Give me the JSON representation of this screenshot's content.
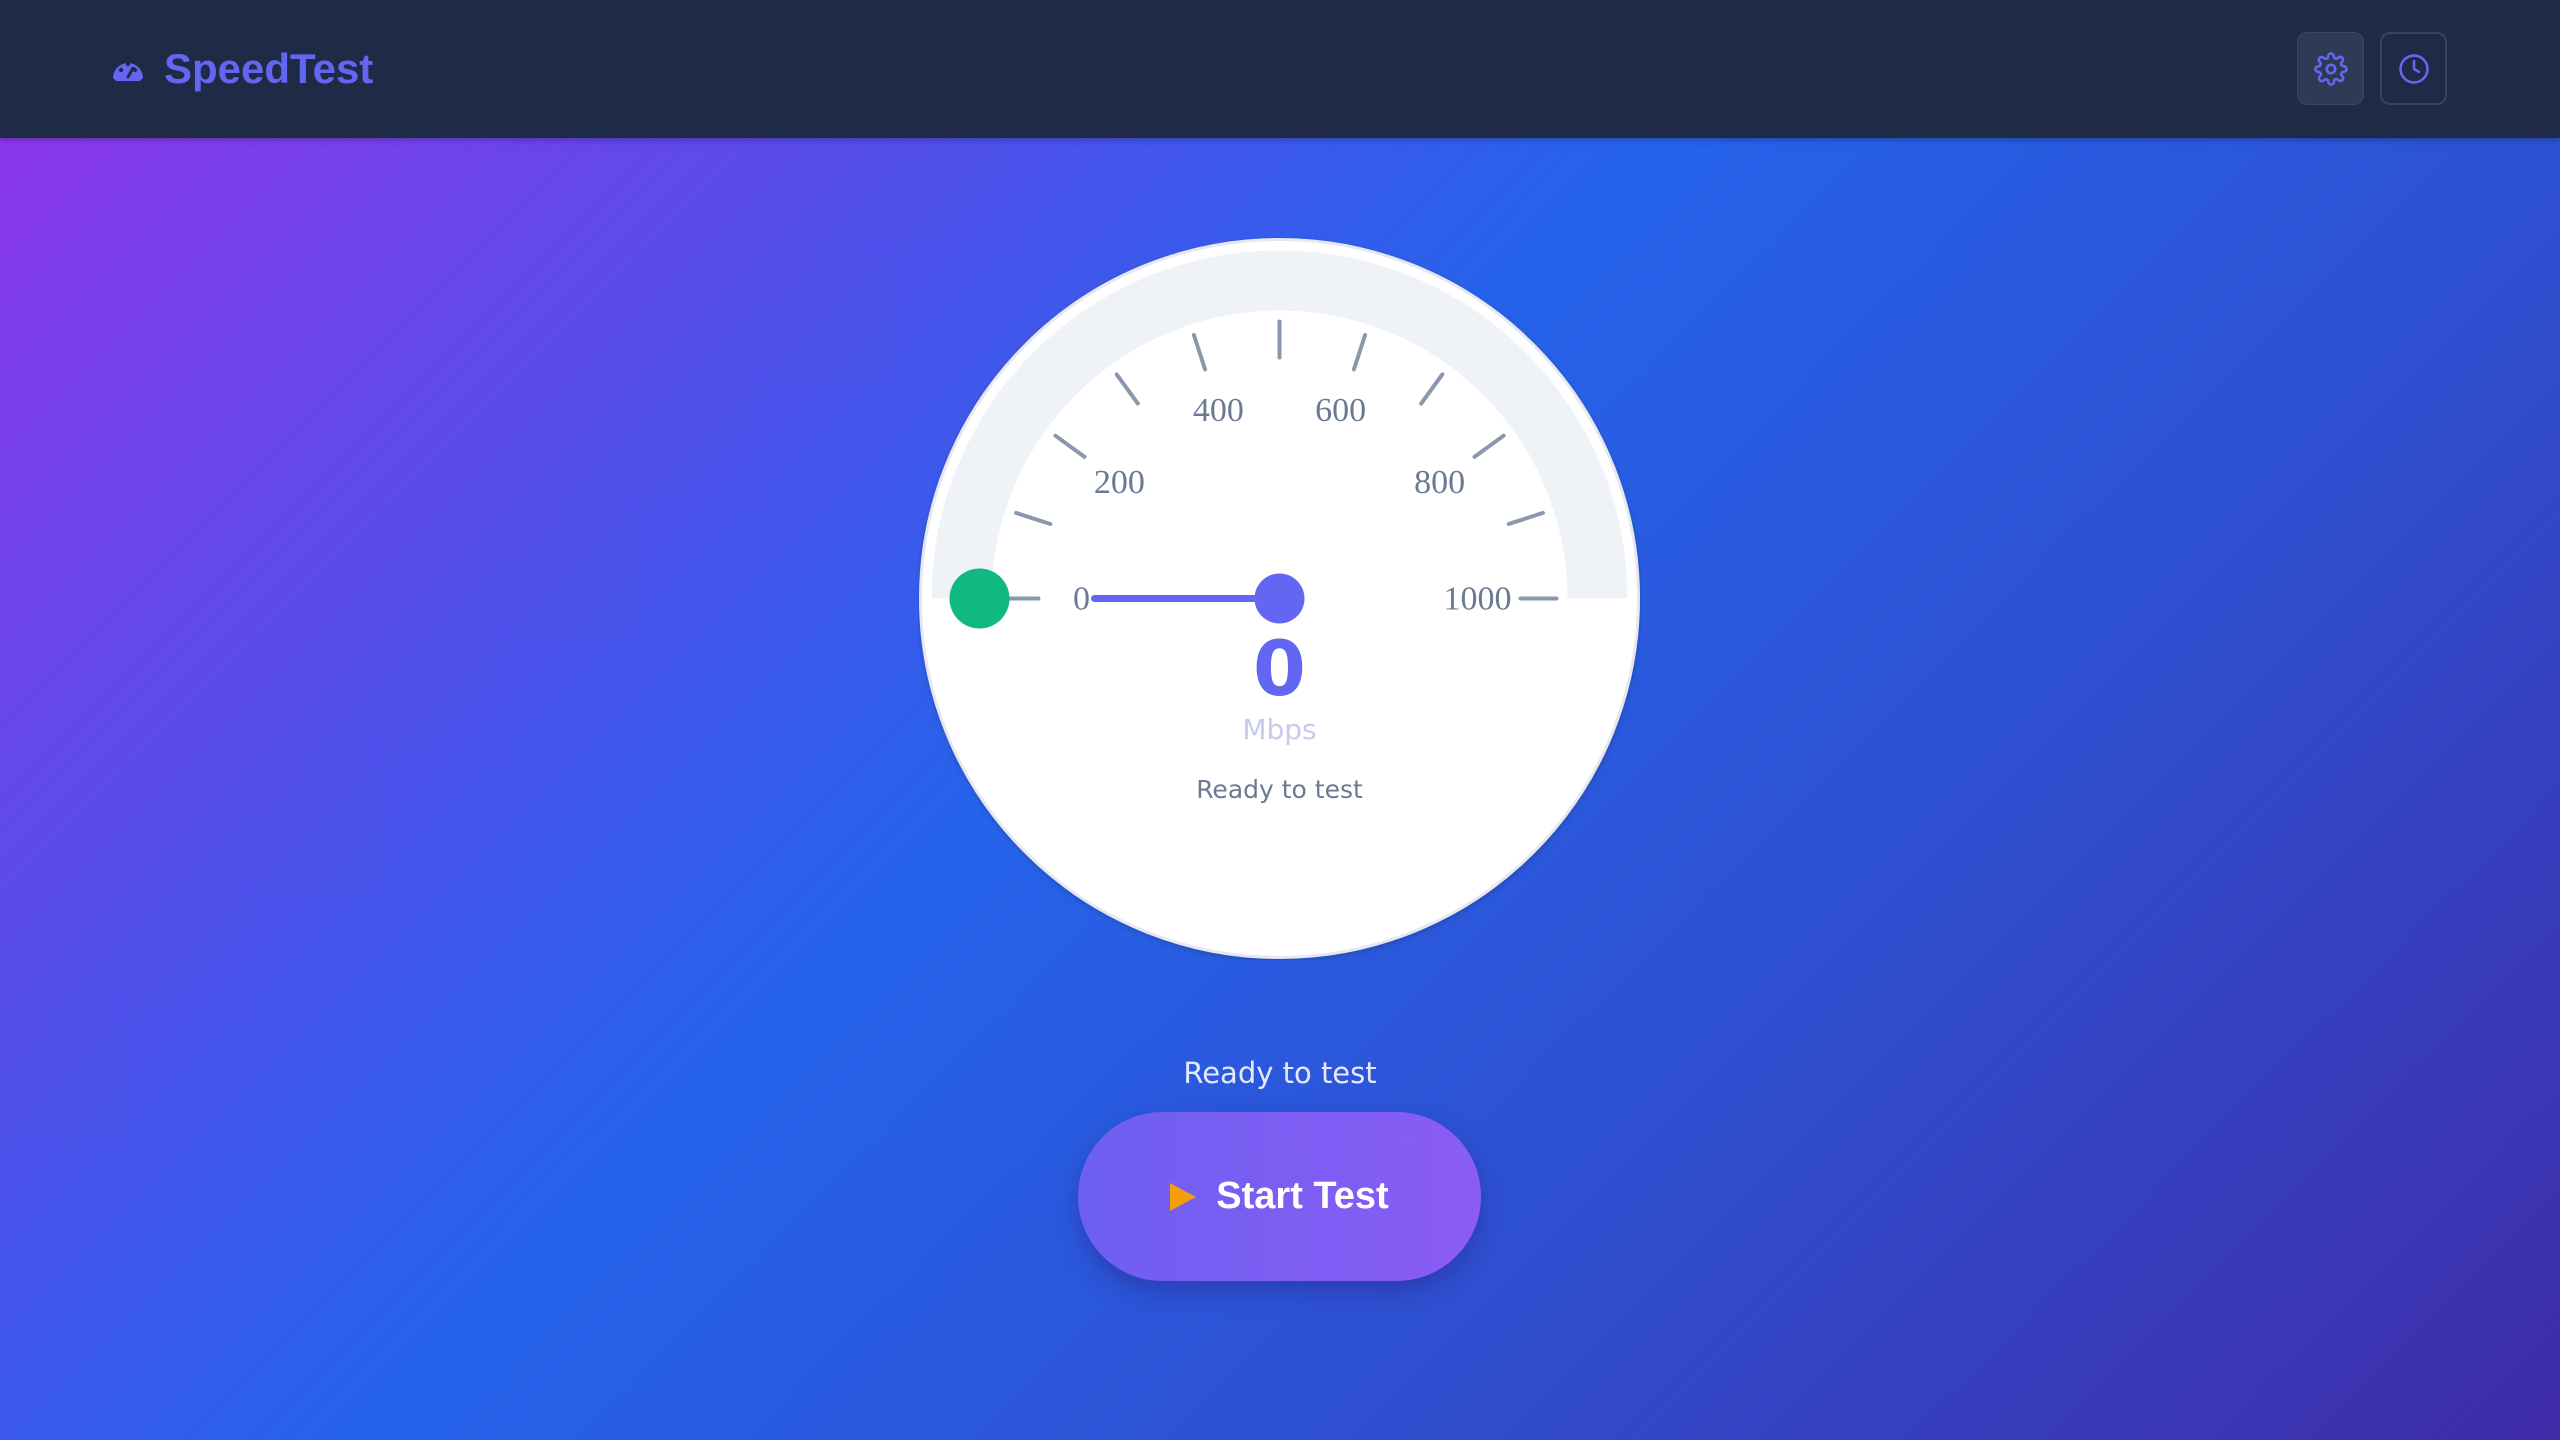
{
  "header": {
    "app_name": "SpeedTest",
    "logo_icon": "gauge-icon",
    "actions": [
      {
        "name": "settings",
        "icon": "gear-icon"
      },
      {
        "name": "history",
        "icon": "clock-icon"
      }
    ]
  },
  "gauge": {
    "ticks": [
      "0",
      "200",
      "400",
      "600",
      "800",
      "1000"
    ],
    "min": 0,
    "max": 1000,
    "value": 0,
    "value_text": "0",
    "unit": "Mbps",
    "status": "Ready to test"
  },
  "status_text": "Ready to test",
  "start_button": {
    "label": "Start Test",
    "icon": "play-icon"
  },
  "colors": {
    "accent": "#6366f1",
    "start_dot": "#10b981",
    "play_icon": "#f59e0b",
    "header_bg": "#1f2a47"
  }
}
